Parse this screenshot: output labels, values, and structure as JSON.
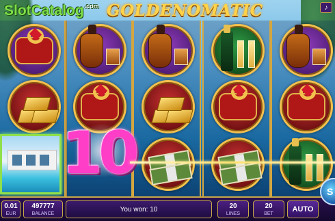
{
  "branding": {
    "site_logo_main": "SlotCatalog",
    "site_logo_sub": ".com",
    "game_title": "GOLDENOMATIC"
  },
  "controls": {
    "sound_icon": "speaker-icon",
    "auto_label": "AUTO",
    "spin_icon": "spin-icon"
  },
  "bottom": {
    "coin_value": "0.01",
    "coin_label": "EUR",
    "balance_value": "497777",
    "balance_label": "BALANCE",
    "message": "You won: 10",
    "lines_value": "20",
    "lines_label": "LINES",
    "bet_value": "20",
    "bet_label": "BET"
  },
  "win": {
    "amount_display": "10"
  },
  "reels": [
    [
      "cushion",
      "gold-bars",
      "mansion"
    ],
    [
      "cognac",
      "cushion",
      "gold-bars"
    ],
    [
      "cognac",
      "gold-bars",
      "cash"
    ],
    [
      "champagne",
      "cushion",
      "cash"
    ],
    [
      "cognac",
      "cushion",
      "champagne"
    ]
  ],
  "colors": {
    "accent_gold": "#c9a84a",
    "win_text": "#ff3ec8",
    "panel": "#2a1150"
  }
}
